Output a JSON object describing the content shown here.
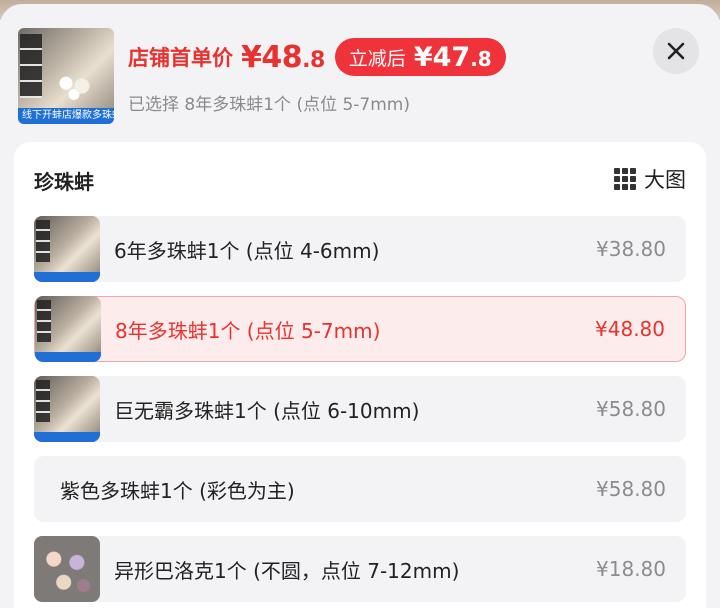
{
  "header": {
    "thumb_banner_text": "线下开蚌店爆款多珠蚌",
    "price_label": "店铺首单价",
    "price_main": "¥48",
    "price_decimal": ".8",
    "promo_label": "立减后",
    "promo_main": "¥47",
    "promo_decimal": ".8",
    "selected_text": "已选择 8年多珠蚌1个 (点位 5-7mm)",
    "close_icon": "close-icon"
  },
  "section": {
    "title": "珍珠蚌",
    "big_view_label": "大图",
    "big_view_icon": "grid-icon"
  },
  "options": [
    {
      "name": "6年多珠蚌1个 (点位 4-6mm)",
      "price": "¥38.80",
      "selected": false
    },
    {
      "name": "8年多珠蚌1个 (点位 5-7mm)",
      "price": "¥48.80",
      "selected": true
    },
    {
      "name": "巨无霸多珠蚌1个 (点位 6-10mm)",
      "price": "¥58.80",
      "selected": false
    },
    {
      "name": "紫色多珠蚌1个 (彩色为主)",
      "price": "¥58.80",
      "selected": false
    },
    {
      "name": "异形巴洛克1个 (不圆，点位 7-12mm)",
      "price": "¥18.80",
      "selected": false
    }
  ],
  "colors": {
    "accent": "#e8322f",
    "selected_bg": "#fdecec",
    "option_bg": "#f3f3f5"
  }
}
